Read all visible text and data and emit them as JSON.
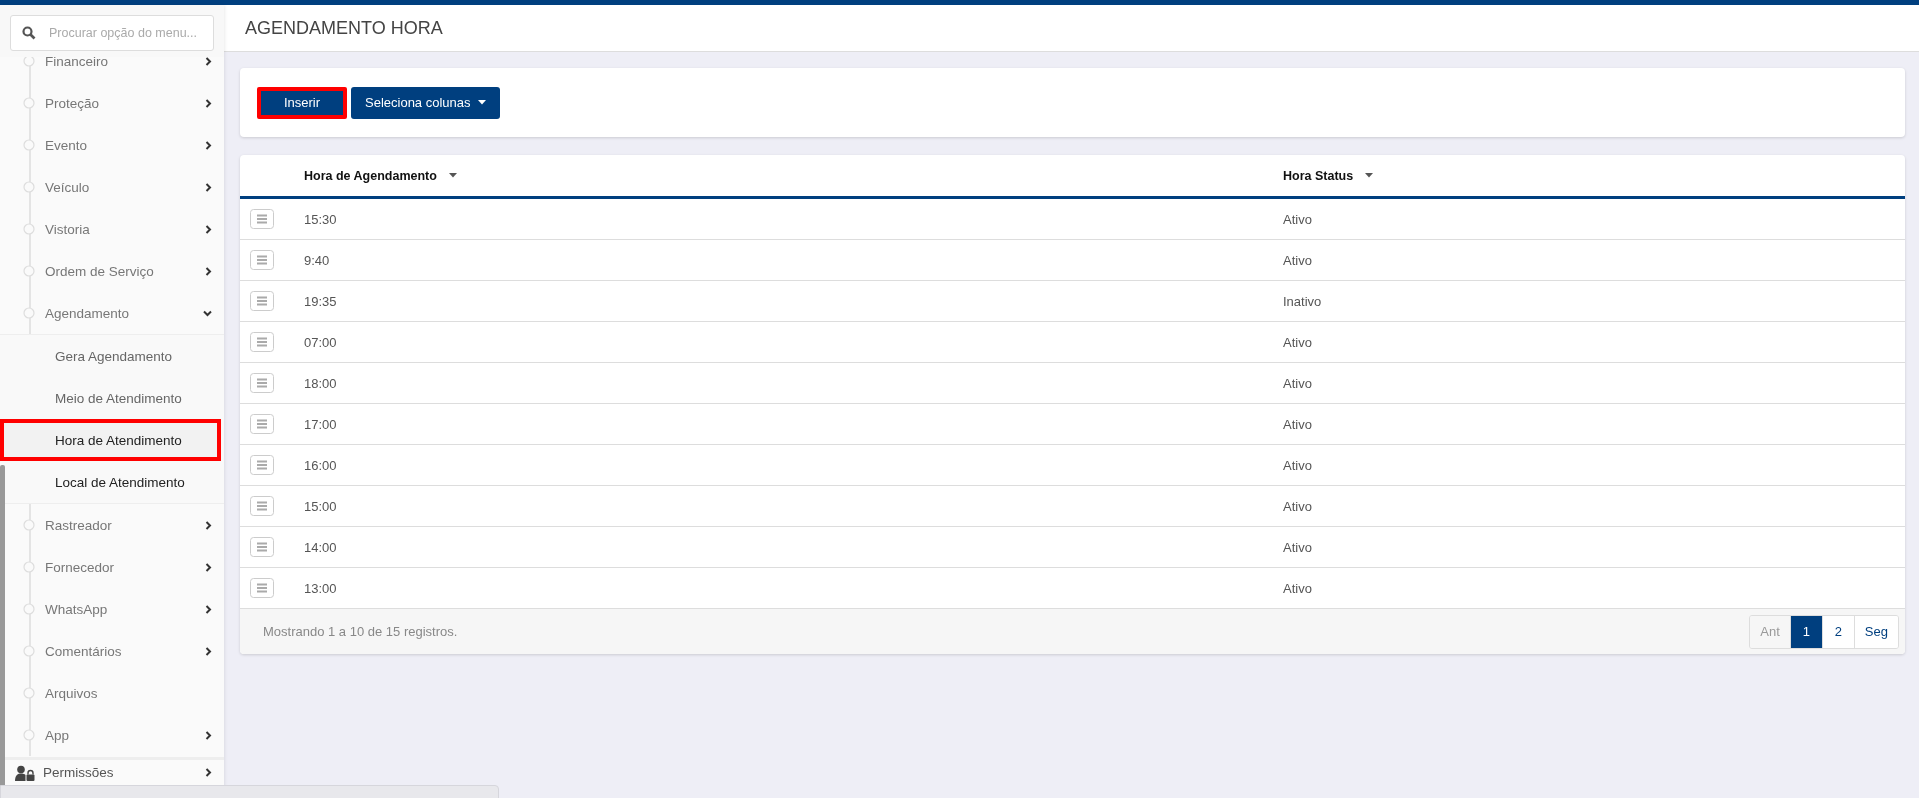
{
  "sidebar": {
    "search": {
      "placeholder": "Procurar opção do menu..."
    },
    "items": [
      {
        "label": "Financeiro",
        "kind": "submenu",
        "expanded": false
      },
      {
        "label": "Proteção",
        "kind": "submenu",
        "expanded": false
      },
      {
        "label": "Evento",
        "kind": "submenu",
        "expanded": false
      },
      {
        "label": "Veículo",
        "kind": "submenu",
        "expanded": false
      },
      {
        "label": "Vistoria",
        "kind": "submenu",
        "expanded": false
      },
      {
        "label": "Ordem de Serviço",
        "kind": "submenu",
        "expanded": false
      },
      {
        "label": "Agendamento",
        "kind": "submenu",
        "expanded": true,
        "children": [
          {
            "label": "Gera Agendamento",
            "selected": false
          },
          {
            "label": "Meio de Atendimento",
            "selected": false
          },
          {
            "label": "Hora de Atendimento",
            "selected": true
          },
          {
            "label": "Local de Atendimento",
            "selected": false
          }
        ]
      },
      {
        "label": "Rastreador",
        "kind": "submenu",
        "expanded": false
      },
      {
        "label": "Fornecedor",
        "kind": "submenu",
        "expanded": false
      },
      {
        "label": "WhatsApp",
        "kind": "submenu",
        "expanded": false
      },
      {
        "label": "Comentários",
        "kind": "submenu",
        "expanded": false
      },
      {
        "label": "Arquivos",
        "kind": "link"
      },
      {
        "label": "App",
        "kind": "submenu",
        "expanded": false
      }
    ],
    "footer_item": {
      "label": "Permissões",
      "expanded": false
    }
  },
  "page": {
    "title": "AGENDAMENTO HORA"
  },
  "toolbar": {
    "buttons": [
      {
        "label": "Inserir",
        "highlighted": true,
        "dropdown": false
      },
      {
        "label": "Seleciona colunas",
        "highlighted": false,
        "dropdown": true
      }
    ]
  },
  "table": {
    "columns": [
      "Hora de Agendamento",
      "Hora Status"
    ],
    "rows": [
      [
        "15:30",
        "Ativo"
      ],
      [
        "9:40",
        "Ativo"
      ],
      [
        "19:35",
        "Inativo"
      ],
      [
        "07:00",
        "Ativo"
      ],
      [
        "18:00",
        "Ativo"
      ],
      [
        "17:00",
        "Ativo"
      ],
      [
        "16:00",
        "Ativo"
      ],
      [
        "15:00",
        "Ativo"
      ],
      [
        "14:00",
        "Ativo"
      ],
      [
        "13:00",
        "Ativo"
      ]
    ],
    "summary": "Mostrando 1 a 10 de 15 registros.",
    "pagination": [
      {
        "label": "Ant",
        "selected": false,
        "disabled": true
      },
      {
        "label": "1",
        "selected": true,
        "disabled": false
      },
      {
        "label": "2",
        "selected": false,
        "disabled": false
      },
      {
        "label": "Seg",
        "selected": false,
        "disabled": false
      }
    ]
  }
}
